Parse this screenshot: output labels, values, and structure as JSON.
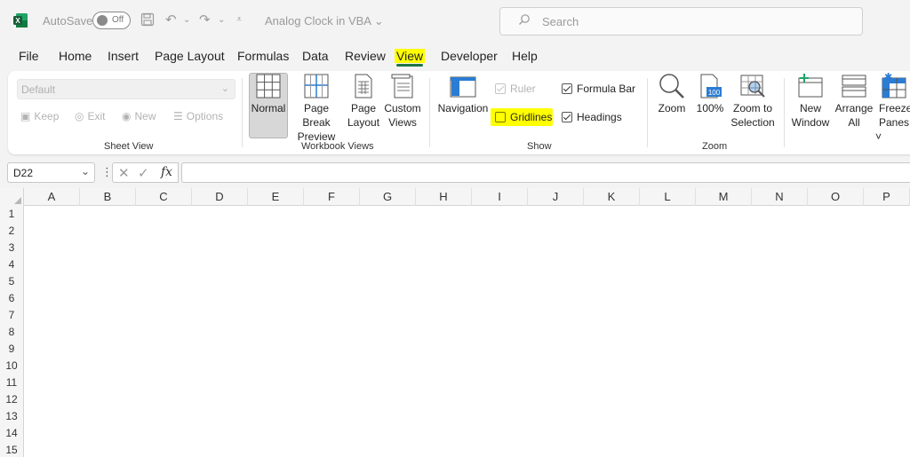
{
  "titlebar": {
    "autosave_label": "AutoSave",
    "autosave_state": "Off",
    "doc_title": "Analog Clock in VBA ⌄",
    "search_placeholder": "Search"
  },
  "tabs": [
    "File",
    "Home",
    "Insert",
    "Page Layout",
    "Formulas",
    "Data",
    "Review",
    "View",
    "Developer",
    "Help"
  ],
  "active_tab": "View",
  "highlight_color": "#ffff00",
  "accent_color": "#217346",
  "ribbon": {
    "sheet_view": {
      "combo_value": "Default",
      "keep": "Keep",
      "exit": "Exit",
      "new": "New",
      "options": "Options",
      "label": "Sheet View"
    },
    "workbook_views": {
      "normal": "Normal",
      "page_break_1": "Page Break",
      "page_break_2": "Preview",
      "page_layout_1": "Page",
      "page_layout_2": "Layout",
      "custom_1": "Custom",
      "custom_2": "Views",
      "label": "Workbook Views"
    },
    "show": {
      "navigation": "Navigation",
      "ruler": "Ruler",
      "gridlines": "Gridlines",
      "formula_bar": "Formula Bar",
      "headings": "Headings",
      "label": "Show"
    },
    "zoom": {
      "zoom": "Zoom",
      "hundred": "100%",
      "zoom_sel_1": "Zoom to",
      "zoom_sel_2": "Selection",
      "label": "Zoom"
    },
    "window": {
      "new_1": "New",
      "new_2": "Window",
      "arrange_1": "Arrange",
      "arrange_2": "All",
      "freeze_1": "Freeze",
      "freeze_2": "Panes ˅"
    }
  },
  "formula_bar": {
    "name_box": "D22",
    "fx": "fx"
  },
  "columns": [
    "A",
    "B",
    "C",
    "D",
    "E",
    "F",
    "G",
    "H",
    "I",
    "J",
    "K",
    "L",
    "M",
    "N",
    "O",
    "P"
  ],
  "rows": [
    "1",
    "2",
    "3",
    "4",
    "5",
    "6",
    "7",
    "8",
    "9",
    "10",
    "11",
    "12",
    "13",
    "14",
    "15"
  ]
}
